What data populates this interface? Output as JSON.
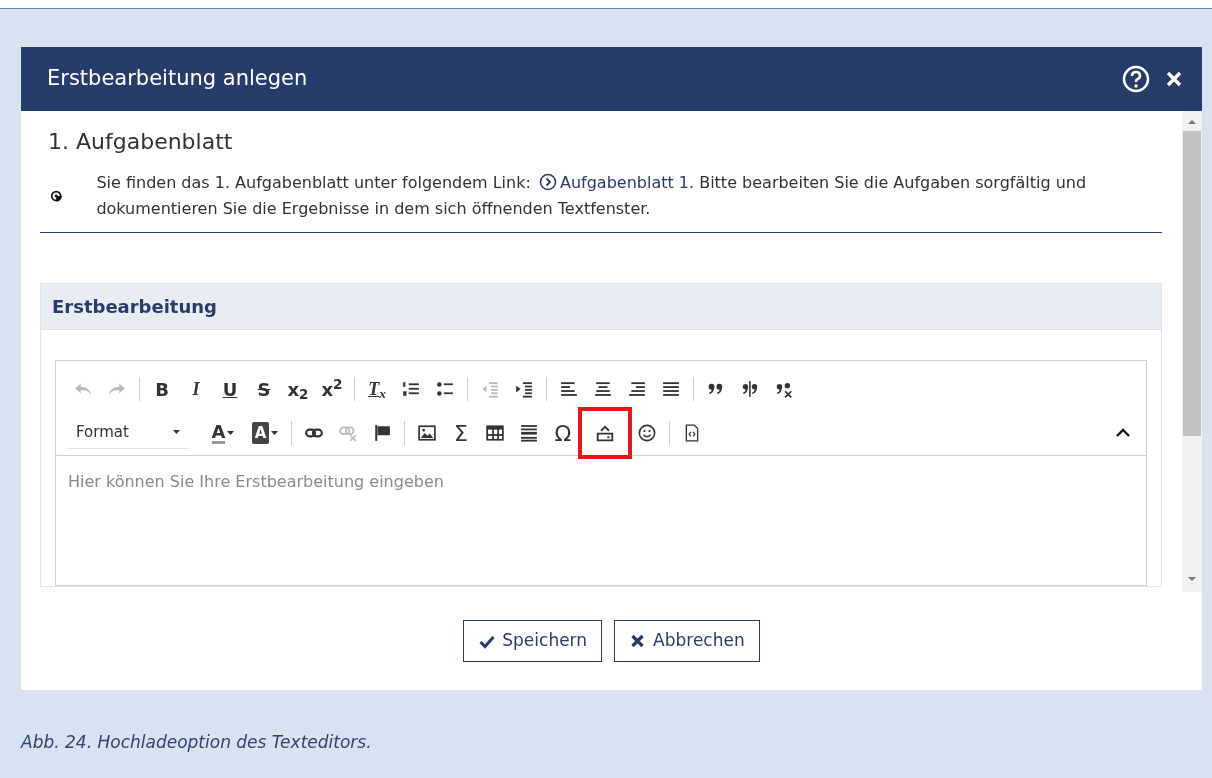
{
  "dialog": {
    "title": "Erstbearbeitung anlegen"
  },
  "task": {
    "heading": "1. Aufgabenblatt",
    "text_before": "Sie finden das 1. Aufgabenblatt unter folgendem Link:",
    "link": "Aufgabenblatt 1",
    "text_after": ". Bitte bearbeiten Sie die Aufgaben sorgfältig und dokumentieren Sie die Ergebnisse in dem sich öffnenden Textfenster."
  },
  "panel": {
    "title": "Erstbearbeitung"
  },
  "toolbar_rows": [
    [
      {
        "kind": "undo",
        "disabled": true
      },
      {
        "kind": "redo",
        "disabled": true
      },
      {
        "kind": "separator"
      },
      {
        "kind": "bold",
        "label": "B",
        "disabled": false
      },
      {
        "kind": "italic",
        "label": "I",
        "disabled": false
      },
      {
        "kind": "underline",
        "label": "U",
        "disabled": false
      },
      {
        "kind": "strike",
        "label": "S",
        "disabled": false
      },
      {
        "kind": "subscript",
        "label": "x$_{2}$",
        "disabled": false
      },
      {
        "kind": "superscript",
        "label": "x$^{2}$",
        "disabled": false
      },
      {
        "kind": "separator"
      },
      {
        "kind": "removeformat",
        "label": "T$_{x}$",
        "disabled": false
      },
      {
        "kind": "numlist",
        "disabled": false
      },
      {
        "kind": "bullist",
        "disabled": false
      },
      {
        "kind": "separator"
      },
      {
        "kind": "outdent",
        "disabled": true
      },
      {
        "kind": "indent",
        "disabled": false
      },
      {
        "kind": "separator"
      },
      {
        "kind": "alignleft",
        "disabled": false
      },
      {
        "kind": "aligncenter",
        "disabled": false
      },
      {
        "kind": "alignright",
        "disabled": false
      },
      {
        "kind": "justify",
        "disabled": false
      },
      {
        "kind": "separator"
      },
      {
        "kind": "quote",
        "disabled": false
      },
      {
        "kind": "quotesplit",
        "disabled": false
      },
      {
        "kind": "quoteremove",
        "disabled": false
      }
    ],
    [
      {
        "kind": "format",
        "label": "Format"
      },
      {
        "kind": "textcolor",
        "label": "A",
        "disabled": false
      },
      {
        "kind": "bgcolor",
        "label": "A",
        "disabled": false
      },
      {
        "kind": "separator"
      },
      {
        "kind": "link",
        "disabled": false
      },
      {
        "kind": "unlink",
        "disabled": true
      },
      {
        "kind": "flag",
        "disabled": false
      },
      {
        "kind": "separator"
      },
      {
        "kind": "image",
        "disabled": false
      },
      {
        "kind": "sigma",
        "label": "Σ",
        "disabled": false
      },
      {
        "kind": "table",
        "disabled": false
      },
      {
        "kind": "hr",
        "disabled": false
      },
      {
        "kind": "omega",
        "label": "Ω",
        "disabled": false
      },
      {
        "kind": "upload",
        "disabled": false,
        "highlighted": true
      },
      {
        "kind": "smiley",
        "disabled": false
      },
      {
        "kind": "separator"
      },
      {
        "kind": "source",
        "disabled": false
      }
    ]
  ],
  "editor": {
    "placeholder": "Hier können Sie Ihre Erstbearbeitung eingeben"
  },
  "buttons": [
    {
      "kind": "save",
      "label": "Speichern"
    },
    {
      "kind": "cancel",
      "label": "Abbrechen"
    }
  ],
  "caption": "Abb. 24. Hochladeoption des Texteditors."
}
